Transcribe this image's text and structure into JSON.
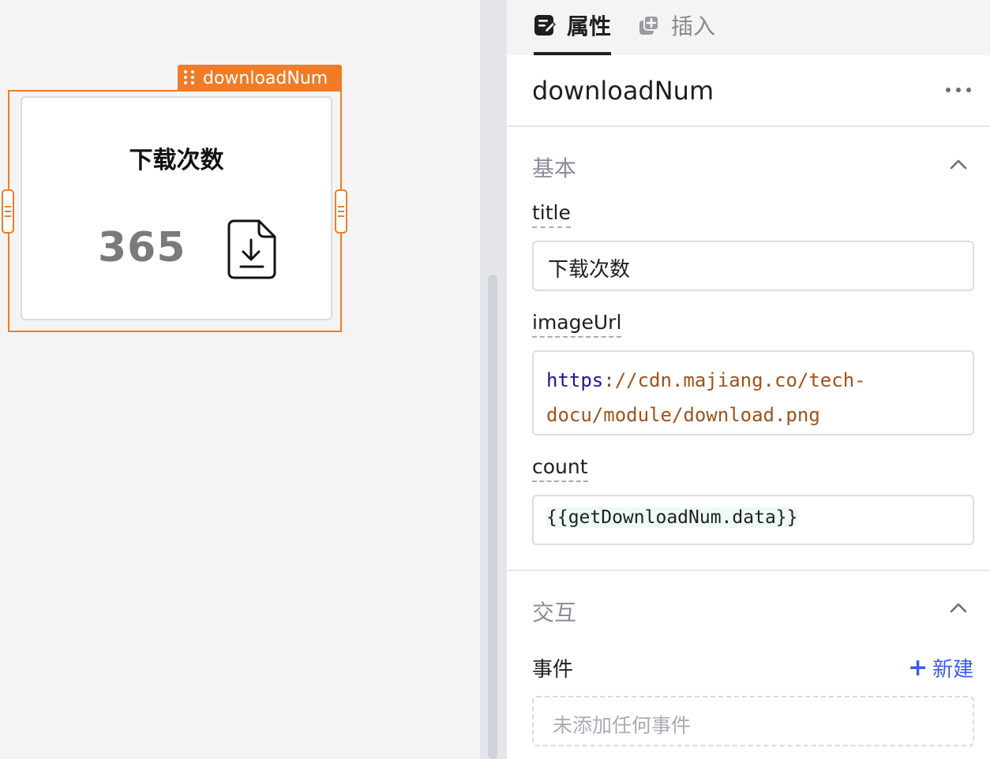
{
  "canvas": {
    "component_tag": "downloadNum",
    "card": {
      "title": "下载次数",
      "count": "365",
      "icon": "file-download-icon"
    }
  },
  "panel": {
    "tabs": [
      {
        "label": "属性",
        "icon": "edit-properties-icon",
        "active": true
      },
      {
        "label": "插入",
        "icon": "insert-copy-icon",
        "active": false
      }
    ],
    "component_name": "downloadNum",
    "more_icon": "more-horizontal-icon",
    "basic": {
      "section_title": "基本",
      "fields": {
        "title": {
          "label": "title",
          "value": "下载次数"
        },
        "imageUrl": {
          "label": "imageUrl",
          "value_scheme": "https",
          "value_colon": ":",
          "value_rest_line1": "//cdn.majiang.co/tech-",
          "value_rest_line2": "docu/module/download.png"
        },
        "count": {
          "label": "count",
          "value": "{{getDownloadNum.data}}"
        }
      }
    },
    "interaction": {
      "section_title": "交互",
      "events_label": "事件",
      "new_button_plus": "+",
      "new_button_label": "新建",
      "empty_text": "未添加任何事件"
    }
  },
  "colors": {
    "accent_orange": "#f07c28",
    "link_blue": "#3d5ce8",
    "canvas_bg": "#f4f4f5"
  }
}
